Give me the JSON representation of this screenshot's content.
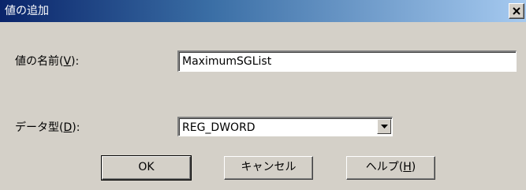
{
  "window": {
    "title": "値の追加",
    "close_label": "×"
  },
  "value_name": {
    "label_prefix": "値の名前(",
    "label_access": "V",
    "label_suffix": "):",
    "value": "MaximumSGList"
  },
  "data_type": {
    "label_prefix": "データ型(",
    "label_access": "D",
    "label_suffix": "):",
    "selected": "REG_DWORD"
  },
  "buttons": {
    "ok": "OK",
    "cancel": "キャンセル",
    "help_prefix": "ヘルプ(",
    "help_access": "H",
    "help_suffix": ")"
  },
  "colors": {
    "dialog_bg": "#d4d0c8",
    "titlebar_start": "#0a246a",
    "titlebar_end": "#a6caf0"
  }
}
